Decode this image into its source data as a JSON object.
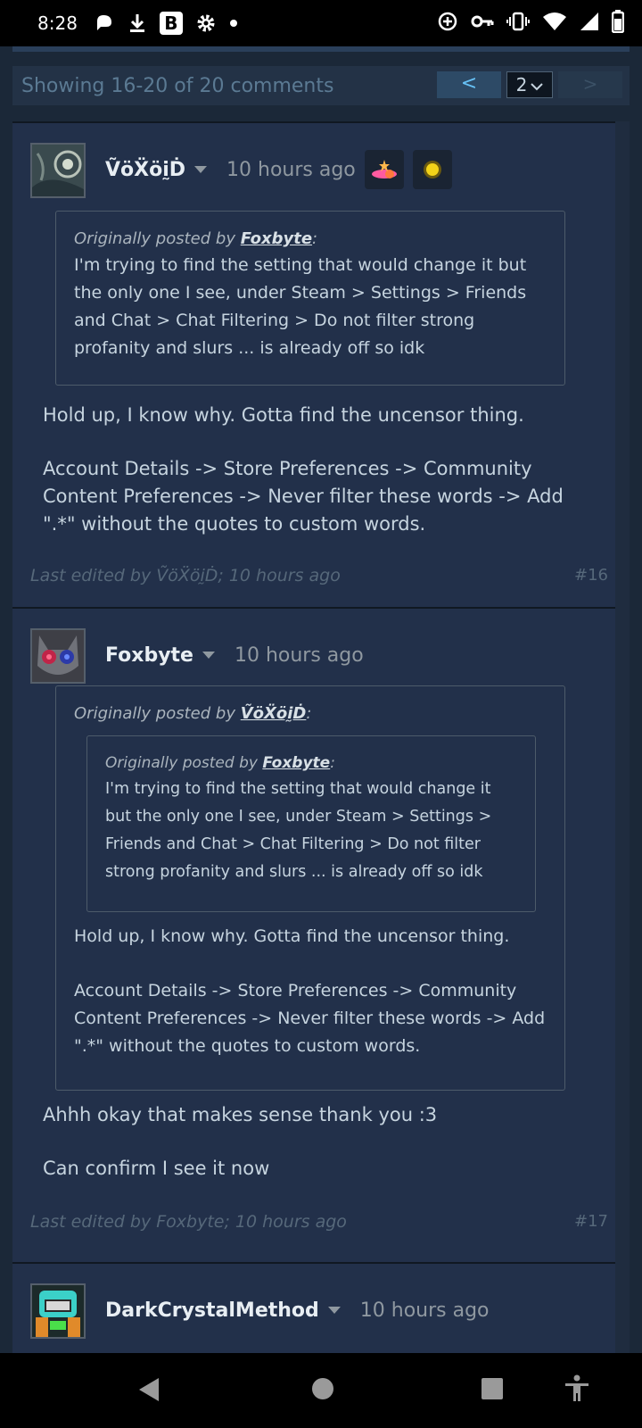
{
  "status_bar": {
    "time": "8:28",
    "left_icons": [
      "pinwheel-icon",
      "download-icon",
      "b-app-icon",
      "gear-icon",
      "dot-icon"
    ],
    "app_letter": "B",
    "right_icons": [
      "add-circle-icon",
      "key-icon",
      "vibrate-icon",
      "wifi-icon",
      "signal-icon",
      "battery-icon"
    ]
  },
  "paging": {
    "showing": "Showing 16-20 of 20 comments",
    "prev_label": "<",
    "page_select": "2",
    "next_label": ">"
  },
  "comments": [
    {
      "author": "ṼöẌöḭḊ",
      "time": "10 hours ago",
      "badges": [
        "shooting-star-badge-icon",
        "sun-badge-icon"
      ],
      "quote": {
        "by_prefix": "Originally posted by ",
        "by_author": "Foxbyte",
        "by_suffix": ":",
        "text": "I'm trying to find the setting that would change it but the only one I see, under Steam > Settings > Friends and Chat > Chat Filtering > Do not filter strong profanity and slurs ... is already off so idk"
      },
      "body": [
        "Hold up, I know why. Gotta find the uncensor thing.",
        "Account Details -> Store Preferences -> Community Content Preferences -> Never filter these words -> Add \".*\" without the quotes to custom words."
      ],
      "edited": "Last edited by ṼöẌöḭḊ; 10 hours ago",
      "number": "#16"
    },
    {
      "author": "Foxbyte",
      "time": "10 hours ago",
      "quote": {
        "by_prefix": "Originally posted by ",
        "by_author": "ṼöẌöḭḊ",
        "by_suffix": ":",
        "inner_quote": {
          "by_prefix": "Originally posted by ",
          "by_author": "Foxbyte",
          "by_suffix": ":",
          "text": "I'm trying to find the setting that would change it but the only one I see, under Steam > Settings > Friends and Chat > Chat Filtering > Do not filter strong profanity and slurs ... is already off so idk"
        },
        "text_1": "Hold up, I know why. Gotta find the uncensor thing.",
        "text_2": "Account Details -> Store Preferences -> Community Content Preferences -> Never filter these words -> Add \".*\" without the quotes to custom words."
      },
      "body": [
        "Ahhh okay that makes sense thank you :3",
        "Can confirm I see it now"
      ],
      "edited": "Last edited by Foxbyte; 10 hours ago",
      "number": "#17"
    },
    {
      "author": "DarkCrystalMethod",
      "time": "10 hours ago"
    }
  ],
  "nav_bar": {
    "icons": [
      "back-icon",
      "home-icon",
      "recents-icon",
      "accessibility-icon"
    ]
  }
}
